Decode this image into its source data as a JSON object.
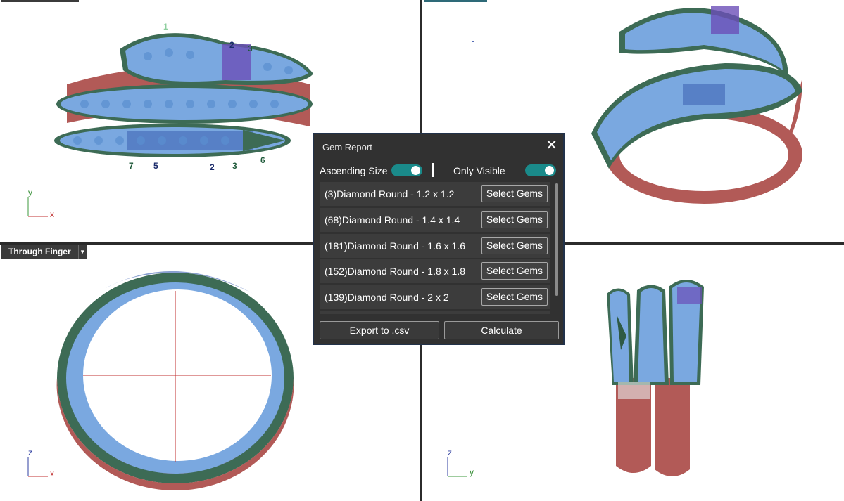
{
  "viewports": {
    "bottom_left": {
      "tab_label": "Through Finger"
    }
  },
  "axes": {
    "top_left": {
      "vertical": "y",
      "horizontal": "x"
    },
    "bottom_left": {
      "vertical": "z",
      "horizontal": "x"
    },
    "bottom_right": {
      "vertical": "z",
      "horizontal": "y"
    }
  },
  "model_labels": [
    "1",
    "2",
    "3",
    "4",
    "5",
    "6",
    "7"
  ],
  "dialog": {
    "title": "Gem Report",
    "close_icon": "close-icon",
    "ascending_label": "Ascending Size",
    "ascending_on": true,
    "visible_label": "Only Visible",
    "visible_on": true,
    "gems": [
      {
        "name": "(3)Diamond Round - 1.2 x 1.2",
        "button": "Select Gems"
      },
      {
        "name": "(68)Diamond Round - 1.4 x 1.4",
        "button": "Select Gems"
      },
      {
        "name": "(181)Diamond Round - 1.6 x 1.6",
        "button": "Select Gems"
      },
      {
        "name": "(152)Diamond Round - 1.8 x 1.8",
        "button": "Select Gems"
      },
      {
        "name": "(139)Diamond Round - 2 x 2",
        "button": "Select Gems"
      }
    ],
    "export_label": "Export to .csv",
    "calculate_label": "Calculate"
  },
  "colors": {
    "accent_toggle": "#1a8a8a",
    "gem_blue": "#7aa8e0",
    "metal_red": "#b25a57",
    "setting_green": "#3d6b55"
  }
}
